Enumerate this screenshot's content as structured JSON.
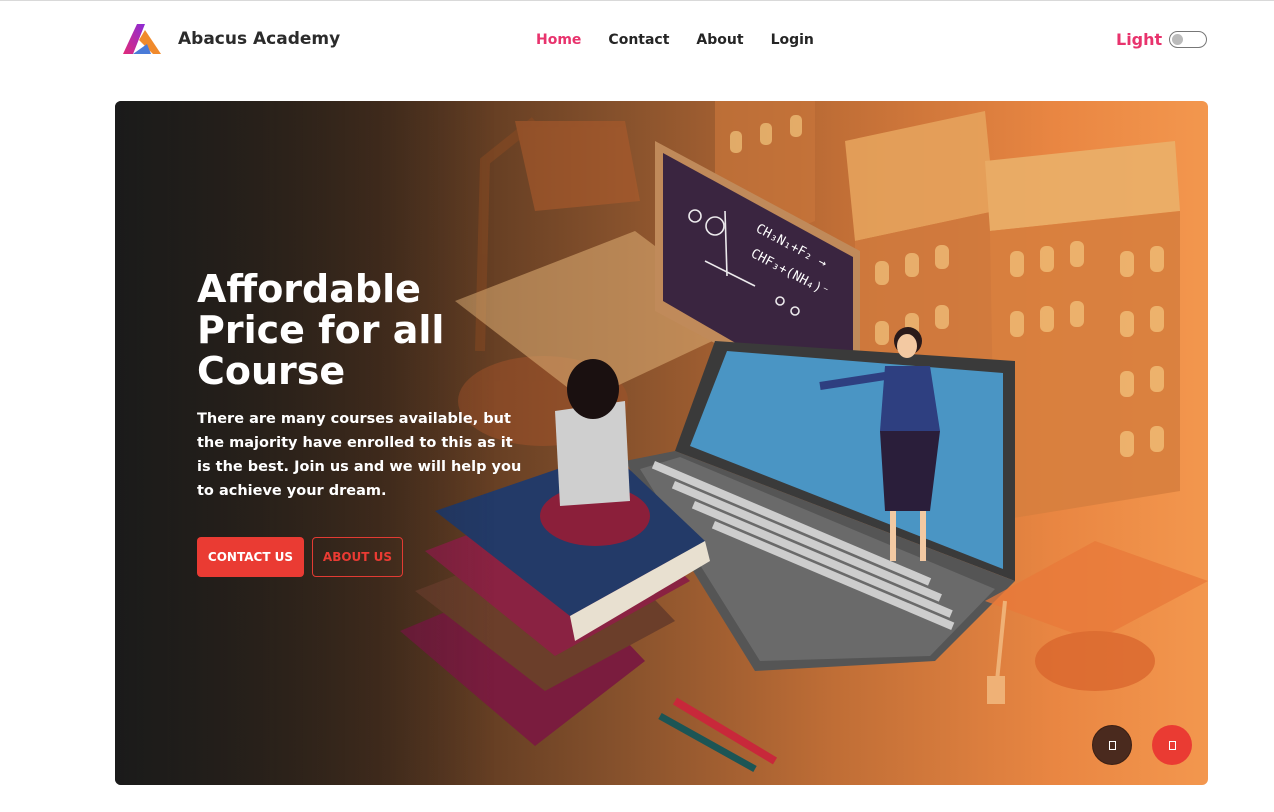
{
  "brand": {
    "name": "Abacus Academy"
  },
  "nav": {
    "items": [
      "Home",
      "Contact",
      "About",
      "Login"
    ],
    "active": "Home"
  },
  "theme": {
    "label": "Light",
    "enabled": false
  },
  "hero": {
    "title": "Affordable Price for all Course",
    "description": "There are many courses available, but the majority have enrolled to this as it is the best. Join us and we will help you to achieve your dream.",
    "primary_button": "CONTACT US",
    "secondary_button": "ABOUT US",
    "board_formula_1": "CH₃N₁+F₂ →",
    "board_formula_2": "CHF₃+(NH₄)⁻"
  },
  "colors": {
    "accent": "#e8336d",
    "button_red": "#ea3b33",
    "hero_dark": "#1b1b1b",
    "hero_orange": "#f3974e"
  },
  "icons": {
    "brand": "abacus-logo",
    "fab_left": "chat-icon",
    "fab_right": "arrow-up-icon"
  }
}
